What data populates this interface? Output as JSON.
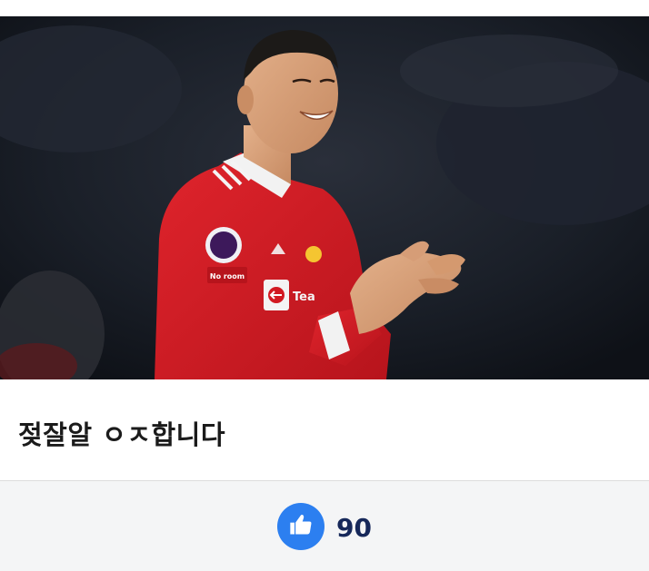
{
  "post": {
    "title": "젖잘알 ㅇㅈ합니다"
  },
  "reaction": {
    "icon": "thumbs-up-icon",
    "count": "90",
    "accent_color": "#2c7ff0"
  },
  "image": {
    "kit_sponsor_text": "TeamViewer",
    "sleeve_badge_text": "No room for racism"
  }
}
